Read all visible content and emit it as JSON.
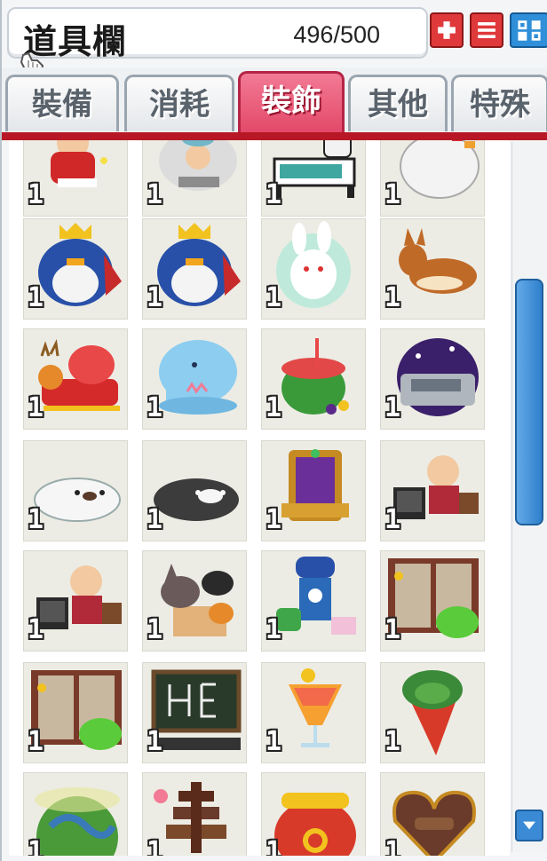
{
  "window": {
    "title": "道具欄",
    "slot_count": "496/500"
  },
  "toolbar": {
    "plus_icon": "plus-icon",
    "menu_icon": "menu-icon",
    "expand_icon": "expand-icon"
  },
  "tabs": [
    {
      "label": "裝備",
      "active": false
    },
    {
      "label": "消耗",
      "active": false
    },
    {
      "label": "裝飾",
      "active": true
    },
    {
      "label": "其他",
      "active": false
    },
    {
      "label": "特殊",
      "active": false
    }
  ],
  "colors": {
    "accent_red": "#e0393b",
    "active_tab": "#e34868",
    "scroll_blue": "#2f7fcc"
  },
  "items": [
    {
      "name": "santa-chair-item",
      "qty": "1"
    },
    {
      "name": "white-beast-item",
      "qty": "1"
    },
    {
      "name": "hospital-bed-item",
      "qty": "1"
    },
    {
      "name": "white-chicken-item",
      "qty": "1"
    },
    {
      "name": "king-penguin-item",
      "qty": "1"
    },
    {
      "name": "king-penguin-item",
      "qty": "1"
    },
    {
      "name": "rabbit-chair-item",
      "qty": "1"
    },
    {
      "name": "corgi-item",
      "qty": "1"
    },
    {
      "name": "reindeer-sleigh-item",
      "qty": "1"
    },
    {
      "name": "elephant-fountain-item",
      "qty": "1"
    },
    {
      "name": "watermelon-drink-item",
      "qty": "1"
    },
    {
      "name": "night-sky-dome-item",
      "qty": "1"
    },
    {
      "name": "white-seal-item",
      "qty": "1"
    },
    {
      "name": "black-seal-item",
      "qty": "1"
    },
    {
      "name": "purple-throne-item",
      "qty": "1"
    },
    {
      "name": "bald-man-tv-item",
      "qty": "1"
    },
    {
      "name": "bald-man-tv-item",
      "qty": "1"
    },
    {
      "name": "cat-box-item",
      "qty": "1"
    },
    {
      "name": "blue-robot-item",
      "qty": "1"
    },
    {
      "name": "door-slime-item",
      "qty": "1"
    },
    {
      "name": "door-slime-item",
      "qty": "1"
    },
    {
      "name": "chalkboard-item",
      "qty": "1"
    },
    {
      "name": "cocktail-item",
      "qty": "1"
    },
    {
      "name": "carrot-item",
      "qty": "1"
    },
    {
      "name": "globe-item",
      "qty": "1"
    },
    {
      "name": "chocolate-fountain-item",
      "qty": "1"
    },
    {
      "name": "lucky-bag-item",
      "qty": "1"
    },
    {
      "name": "chocolate-heart-item",
      "qty": "1"
    }
  ]
}
